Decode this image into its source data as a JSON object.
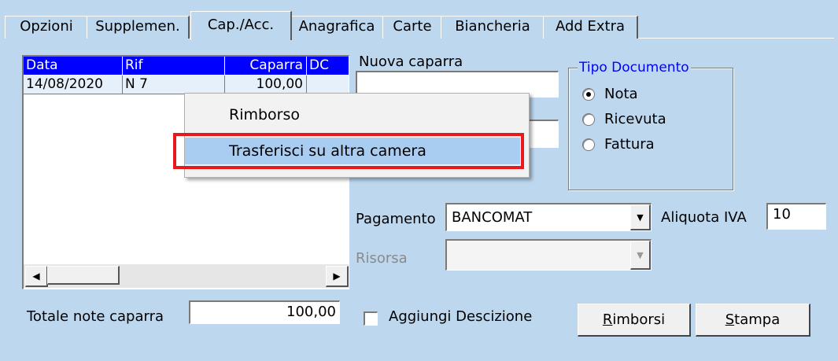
{
  "tabs": [
    {
      "label": "Opzioni"
    },
    {
      "label": "Supplemen."
    },
    {
      "label": "Cap./Acc."
    },
    {
      "label": "Anagrafica"
    },
    {
      "label": "Carte"
    },
    {
      "label": "Biancheria"
    },
    {
      "label": "Add Extra"
    }
  ],
  "grid": {
    "columns": [
      "Data",
      "Rif",
      "Caparra",
      "DC"
    ],
    "rows": [
      {
        "data": "14/08/2020",
        "rif": "N 7",
        "caparra": "100,00",
        "dc": ""
      }
    ]
  },
  "nuova_caparra": {
    "label": "Nuova caparra",
    "value": ""
  },
  "second_field": {
    "value": ""
  },
  "tipo_documento": {
    "legend": "Tipo Documento",
    "options": [
      {
        "label": "Nota",
        "selected": true
      },
      {
        "label": "Ricevuta",
        "selected": false
      },
      {
        "label": "Fattura",
        "selected": false
      }
    ]
  },
  "context_menu": {
    "items": [
      {
        "label": "Rimborso"
      },
      {
        "label": "Trasferisci su altra camera"
      }
    ],
    "highlight_color": "#e8191d"
  },
  "pagamento": {
    "label": "Pagamento",
    "value": "BANCOMAT"
  },
  "aliquota": {
    "label": "Aliquota IVA",
    "value": "10"
  },
  "risorsa": {
    "label": "Risorsa",
    "value": ""
  },
  "totale": {
    "label": "Totale note caparra",
    "value": "100,00"
  },
  "aggiungi": {
    "label": "Aggiungi Descizione",
    "checked": false
  },
  "buttons": {
    "rimborsi": {
      "access": "R",
      "rest": "imborsi"
    },
    "stampa": {
      "access": "S",
      "rest": "tampa"
    }
  },
  "colors": {
    "background": "#bdd7ee",
    "grid_header": "#0000ff",
    "legend": "#0000ff",
    "menu_selected": "#a8cdf0"
  }
}
